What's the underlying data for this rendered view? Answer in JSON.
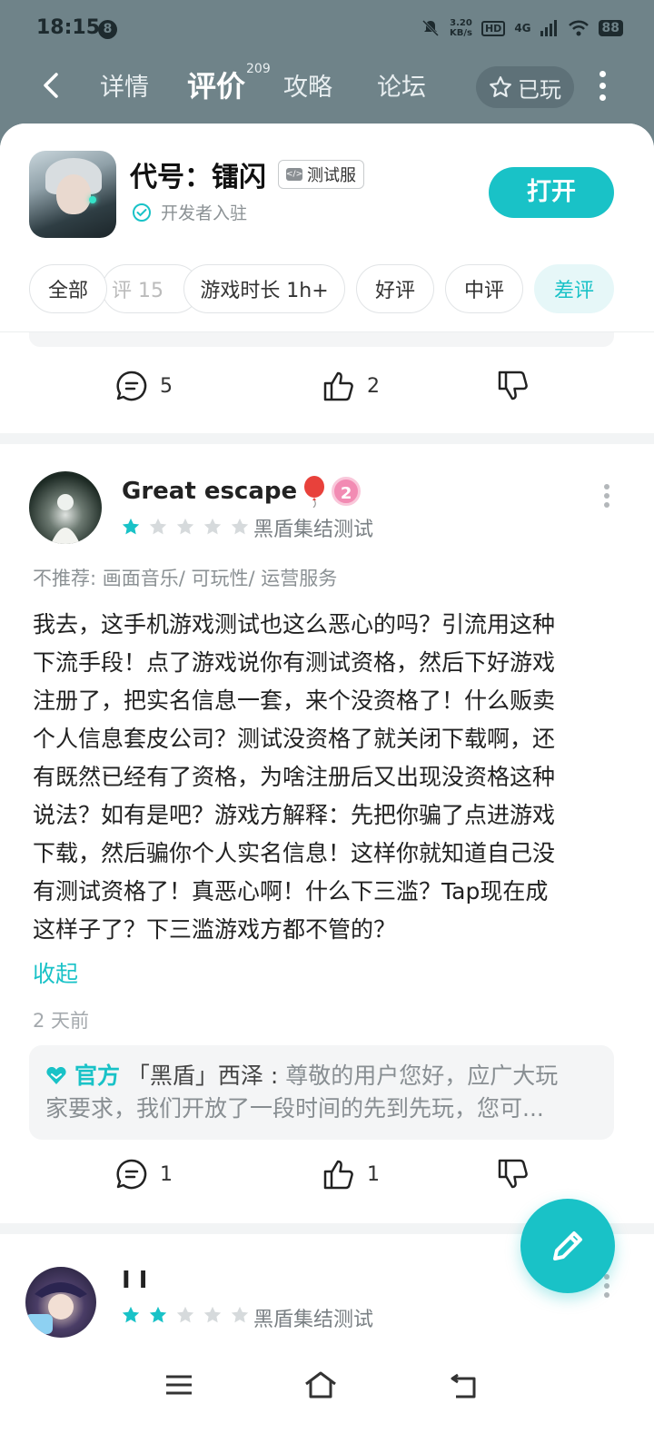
{
  "status_bar": {
    "time": "18:15",
    "notification_count": "8",
    "net_speed_value": "3.20",
    "net_speed_unit": "KB/s",
    "hd": "HD",
    "network": "4G",
    "battery": "88"
  },
  "nav": {
    "tabs": [
      {
        "label": "详情",
        "active": false
      },
      {
        "label": "评价",
        "active": true,
        "count": "209"
      },
      {
        "label": "攻略",
        "active": false
      },
      {
        "label": "论坛",
        "active": false
      }
    ],
    "played_label": "已玩"
  },
  "game": {
    "title": "代号：镭闪",
    "badge": "测试服",
    "developer_label": "开发者入驻",
    "open_button": "打开"
  },
  "filters": [
    {
      "label": "全部",
      "active": false
    },
    {
      "label": "评 15",
      "active": false
    },
    {
      "label": "游戏时长 1h+",
      "active": false
    },
    {
      "label": "好评",
      "active": false
    },
    {
      "label": "中评",
      "active": false
    },
    {
      "label": "差评",
      "active": true
    }
  ],
  "prev_review": {
    "comments": "5",
    "likes": "2"
  },
  "review": {
    "username": "Great escape",
    "level": "2",
    "rating": 1,
    "device": "黑盾集结测试",
    "not_recommend": "不推荐: 画面音乐/ 可玩性/ 运营服务",
    "lines": [
      "我去，这手机游戏测试也这么恶心的吗？引流用这种",
      "下流手段！点了游戏说你有测试资格，然后下好游戏",
      "注册了，把实名信息一套，来个没资格了！什么贩卖",
      "个人信息套皮公司？测试没资格了就关闭下载啊，还",
      "有既然已经有了资格，为啥注册后又出现没资格这种",
      "说法？如有是吧？游戏方解释：先把你骗了点进游戏",
      "下载，然后骗你个人实名信息！这样你就知道自己没",
      "有测试资格了！真恶心啊！什么下三滥？Tap现在成",
      "这样子了？下三滥游戏方都不管的？"
    ],
    "collapse": "收起",
    "time_ago": "2 天前",
    "official_tag": "官方",
    "official_name": "「黑盾」西泽",
    "official_line1": "尊敬的用户您好，应广大玩",
    "official_line2": "家要求，我们开放了一段时间的先到先玩，您可...",
    "comments": "1",
    "likes": "1"
  },
  "next_review": {
    "username": "I I",
    "rating": 2,
    "device": "黑盾集结测试"
  },
  "colors": {
    "accent": "#19c2c7",
    "header_bg": "#6f8389",
    "star_on": "#19c2c7",
    "star_off": "#d6dadc"
  }
}
